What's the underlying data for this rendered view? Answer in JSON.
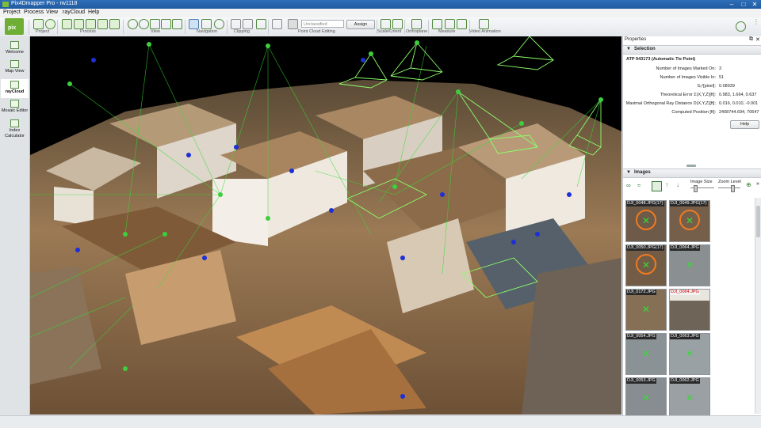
{
  "window": {
    "title": "Pix4Dmapper Pro - rw1118",
    "controls": [
      "–",
      "□",
      "✕"
    ]
  },
  "menu": [
    "Project",
    "Process",
    "View",
    "rayCloud",
    "Help"
  ],
  "toolbar": {
    "groups": [
      "Project",
      "Process",
      "View",
      "Navigation",
      "Clipping",
      "Point Cloud Editing",
      "Scale/Orient",
      "Orthoplane",
      "Measure",
      "Video Animation"
    ],
    "class_select": "Unclassified",
    "assign_label": "Assign"
  },
  "sidebar": [
    "Welcome",
    "Map View",
    "rayCloud",
    "Mosaic Editor",
    "Index Calculator"
  ],
  "properties": {
    "title": "Properties",
    "selection": {
      "header": "Selection",
      "name": "ATP 943173 (Automatic Tie Point)",
      "rows": [
        {
          "k": "Number of Images Marked On:",
          "v": "3"
        },
        {
          "k": "Number of Images Visible In:",
          "v": "51"
        },
        {
          "k": "S₀²[pixel]:",
          "v": "0.08939"
        },
        {
          "k": "Theoretical Error Σ(X,Y,Z)[ft]:",
          "v": "0.983, 1.664, 0.637"
        },
        {
          "k": "Maximal Orthogonal Ray Distance D(X,Y,Z)[ft]:",
          "v": "0.016, 0.010, -0.001"
        },
        {
          "k": "Computed Position [ft]:",
          "v": "2408744.694, 70647"
        }
      ],
      "help_label": "Help"
    },
    "images": {
      "header": "Images",
      "image_size_label": "Image Size",
      "zoom_level_label": "Zoom Level",
      "thumbs": [
        {
          "label": "DJI_0048.JPG(17)",
          "marked": true
        },
        {
          "label": "DJI_0049.JPG(17)",
          "marked": true
        },
        {
          "label": "DJI_0050.JPG(17)",
          "marked": true
        },
        {
          "label": "DJI_0064.JPG",
          "marked": false
        },
        {
          "label": "DJI_0172.JPG",
          "marked": false
        },
        {
          "label": "DJI_0084.JPG",
          "marked": false
        },
        {
          "label": "DJI_0054.JPG",
          "marked": false
        },
        {
          "label": "DJI_0063.JPG",
          "marked": false
        },
        {
          "label": "DJI_0053.JPG",
          "marked": false
        },
        {
          "label": "DJI_0062.JPG",
          "marked": false
        }
      ]
    }
  },
  "colors": {
    "accent_green": "#79b83a",
    "ray_green": "#33dd33",
    "camera_blue": "#1d2fd6",
    "title_blue": "#2a66b0"
  }
}
